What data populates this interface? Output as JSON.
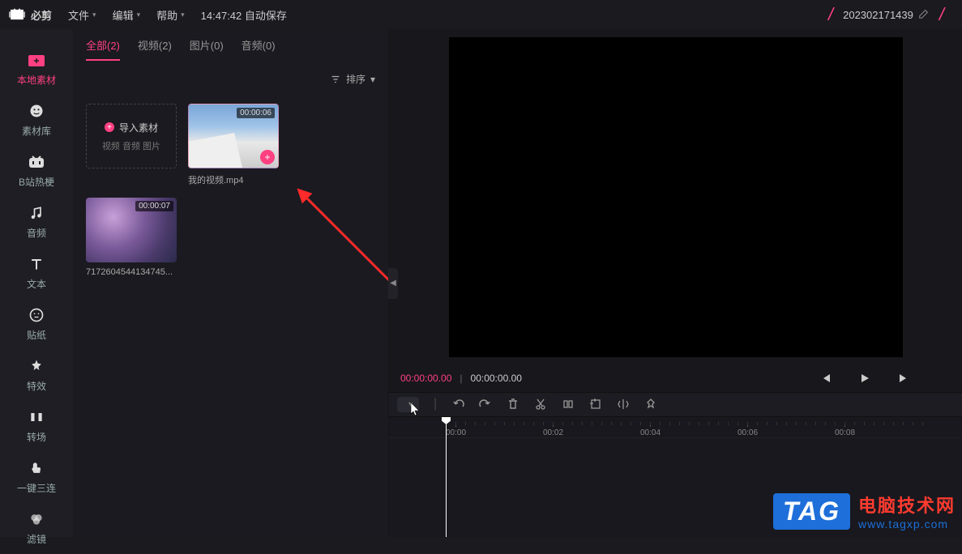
{
  "topbar": {
    "app_name": "必剪",
    "menus": {
      "file": "文件",
      "edit": "编辑",
      "help": "帮助"
    },
    "autosave": "14:47:42 自动保存",
    "project_name": "202302171439"
  },
  "sidebar": {
    "items": [
      {
        "label": "本地素材",
        "icon": "folder-upload-icon",
        "active": true
      },
      {
        "label": "素材库",
        "icon": "smile-icon"
      },
      {
        "label": "B站热梗",
        "icon": "bilibili-icon"
      },
      {
        "label": "音频",
        "icon": "music-note-icon"
      },
      {
        "label": "文本",
        "icon": "text-icon"
      },
      {
        "label": "贴纸",
        "icon": "sticker-icon"
      },
      {
        "label": "特效",
        "icon": "sparkle-icon"
      },
      {
        "label": "转场",
        "icon": "transition-icon"
      },
      {
        "label": "一键三连",
        "icon": "thumbs-up-icon"
      },
      {
        "label": "滤镜",
        "icon": "filter-icon"
      }
    ]
  },
  "asset_panel": {
    "tabs": [
      {
        "label": "全部(2)",
        "active": true
      },
      {
        "label": "视频(2)"
      },
      {
        "label": "图片(0)"
      },
      {
        "label": "音频(0)"
      }
    ],
    "sort_label": "排序",
    "import_card": {
      "title": "导入素材",
      "subtitle": "视频 音频 图片"
    },
    "assets": [
      {
        "name": "我的视频.mp4",
        "duration": "00:00:06",
        "thumb_class": "thumb-sky",
        "has_add": true
      },
      {
        "name": "7172604544134745...",
        "duration": "00:00:07",
        "thumb_class": "thumb-glitter",
        "has_add": false
      }
    ]
  },
  "playback": {
    "current": "00:00:00.00",
    "total": "00:00:00.00"
  },
  "timeline": {
    "ticks": [
      "00:00",
      "00:02",
      "00:04",
      "00:06",
      "00:08"
    ]
  },
  "watermark": {
    "tag": "TAG",
    "line1": "电脑技术网",
    "line2": "www.tagxp.com"
  }
}
